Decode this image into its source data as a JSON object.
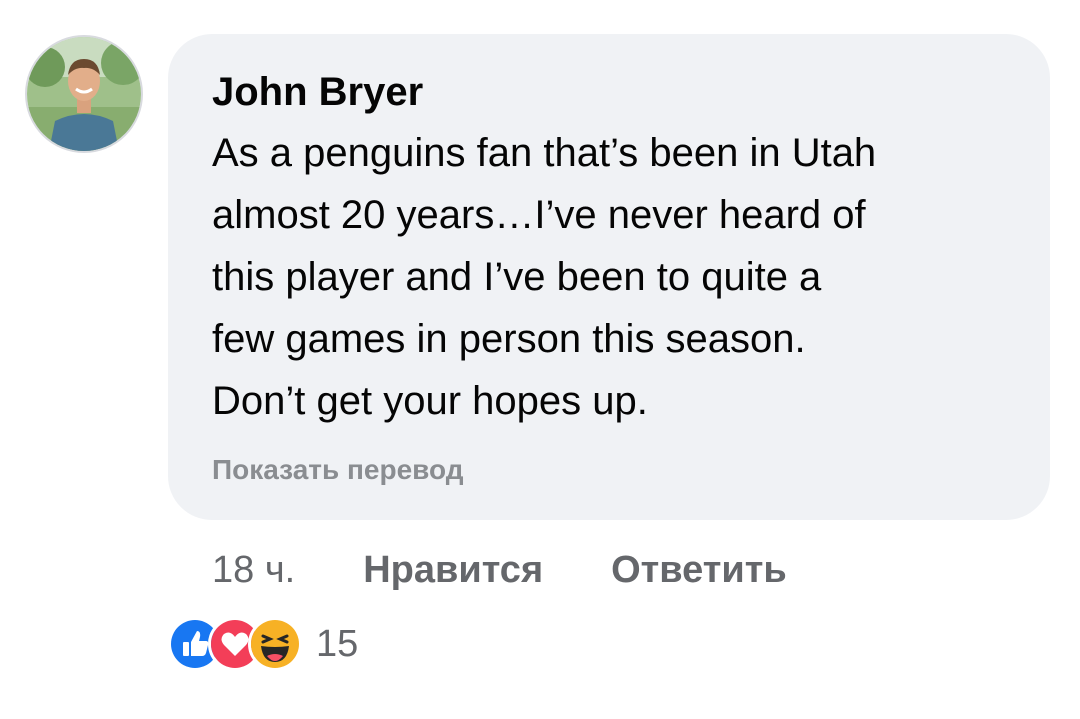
{
  "comment": {
    "author": "John Bryer",
    "text": "As a penguins fan that’s been in Utah\nalmost 20 years…I’ve never heard of\nthis player and I’ve been to quite a\nfew games in person this season.\nDon’t get your hopes up.",
    "translate_link": "Показать перевод"
  },
  "actions": {
    "timestamp": "18 ч.",
    "like_label": "Нравится",
    "reply_label": "Ответить"
  },
  "reactions": {
    "icons": [
      "like-icon",
      "love-icon",
      "haha-icon"
    ],
    "count": "15"
  },
  "colors": {
    "bubble": "#f0f2f5",
    "like_blue": "#1877f2",
    "love_red": "#f33e58",
    "haha_yellow": "#f7b125",
    "meta_gray": "#65676b",
    "translate_gray": "#8a8d91"
  }
}
